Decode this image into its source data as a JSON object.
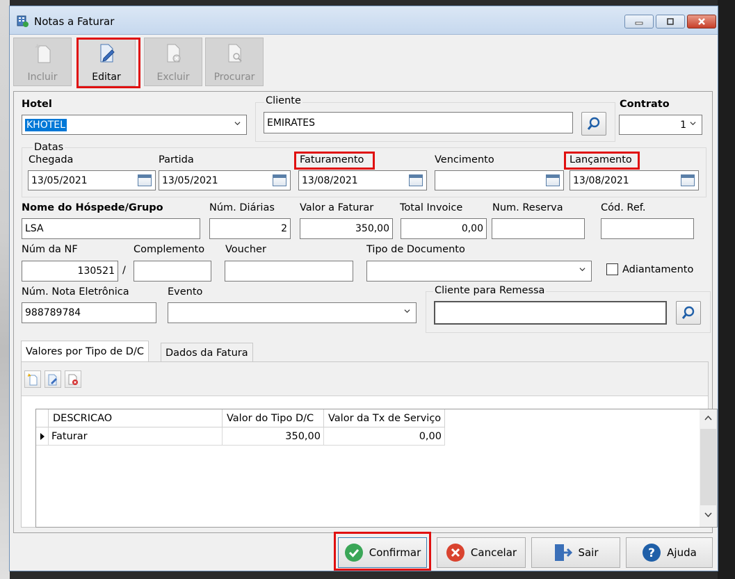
{
  "window": {
    "title": "Notas a Faturar"
  },
  "toolbar": {
    "incluir": "Incluir",
    "editar": "Editar",
    "excluir": "Excluir",
    "procurar": "Procurar"
  },
  "form": {
    "hotel_label": "Hotel",
    "hotel_value": "KHOTEL",
    "cliente_label": "Cliente",
    "cliente_value": "EMIRATES",
    "contrato_label": "Contrato",
    "contrato_value": "1",
    "datas_label": "Datas",
    "chegada_label": "Chegada",
    "chegada_value": "13/05/2021",
    "partida_label": "Partida",
    "partida_value": "13/05/2021",
    "faturamento_label": "Faturamento",
    "faturamento_value": "13/08/2021",
    "vencimento_label": "Vencimento",
    "vencimento_value": "",
    "lancamento_label": "Lançamento",
    "lancamento_value": "13/08/2021",
    "hospede_label": "Nome do Hóspede/Grupo",
    "hospede_value": "LSA",
    "diarias_label": "Núm. Diárias",
    "diarias_value": "2",
    "valor_label": "Valor a Faturar",
    "valor_value": "350,00",
    "invoice_label": "Total Invoice",
    "invoice_value": "0,00",
    "reserva_label": "Num. Reserva",
    "reserva_value": "",
    "codref_label": "Cód. Ref.",
    "codref_value": "",
    "nf_label": "Núm da NF",
    "nf_value": "130521",
    "nf_sep": "/",
    "complemento_label": "Complemento",
    "complemento_value": "",
    "voucher_label": "Voucher",
    "voucher_value": "",
    "tipodoc_label": "Tipo de Documento",
    "tipodoc_value": "",
    "adiantamento_label": "Adiantamento",
    "nfe_label": "Núm. Nota Eletrônica",
    "nfe_value": "988789784",
    "evento_label": "Evento",
    "evento_value": "",
    "remessa_label": "Cliente para Remessa",
    "remessa_value": ""
  },
  "tabs": [
    "Valores por Tipo de D/C",
    "Dados da Fatura"
  ],
  "grid": {
    "columns": [
      "DESCRICAO",
      "Valor do Tipo D/C",
      "Valor da Tx de Serviço"
    ],
    "rows": [
      [
        "Faturar",
        "350,00",
        "0,00"
      ]
    ]
  },
  "actions": {
    "confirmar": "Confirmar",
    "cancelar": "Cancelar",
    "sair": "Sair",
    "ajuda": "Ajuda"
  },
  "colors": {
    "highlight": "#e01010",
    "selection": "#0078d7"
  },
  "icons": [
    "app-icon",
    "minimize-icon",
    "maximize-icon",
    "close-icon",
    "new-document-icon",
    "edit-document-icon",
    "delete-document-icon",
    "find-document-icon",
    "search-icon",
    "calendar-icon",
    "chevron-down-icon",
    "check-icon",
    "cancel-icon",
    "exit-icon",
    "help-icon"
  ]
}
